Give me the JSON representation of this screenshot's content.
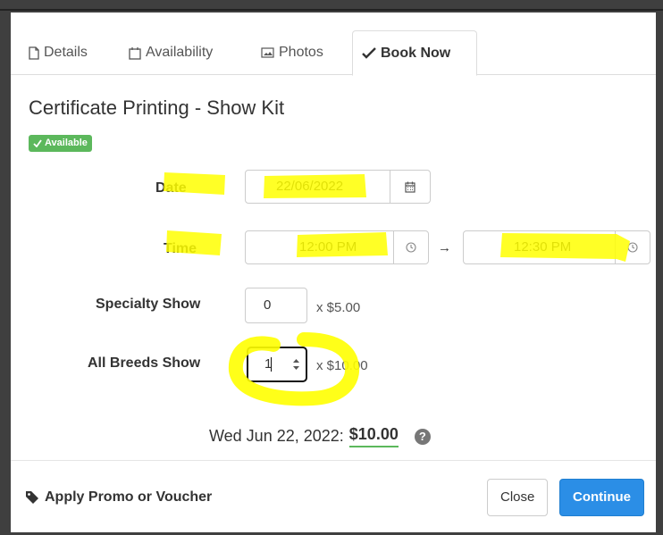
{
  "tabs": [
    {
      "label": "Details",
      "icon": "file-icon"
    },
    {
      "label": "Availability",
      "icon": "calendar-icon"
    },
    {
      "label": "Photos",
      "icon": "image-icon"
    },
    {
      "label": "Book Now",
      "icon": "check-icon"
    }
  ],
  "title": "Certificate Printing - Show Kit",
  "status_badge": "Available",
  "form": {
    "date_label": "Date",
    "date_value": "22/06/2022",
    "time_label": "Time",
    "time_start": "12:00 PM",
    "time_end": "12:30 PM",
    "arrow": "→",
    "specialty_label": "Specialty Show",
    "specialty_qty": "0",
    "specialty_price": "x $5.00",
    "allbreeds_label": "All Breeds Show",
    "allbreeds_qty": "1",
    "allbreeds_price": "x $10.00"
  },
  "summary": {
    "date_text": "Wed Jun 22, 2022:",
    "price": "$10.00",
    "help": "?"
  },
  "footer": {
    "promo": "Apply Promo or Voucher",
    "close": "Close",
    "continue": "Continue"
  },
  "colors": {
    "highlight": "#ffff00",
    "success": "#5cb85c",
    "primary": "#2b8ee6"
  }
}
